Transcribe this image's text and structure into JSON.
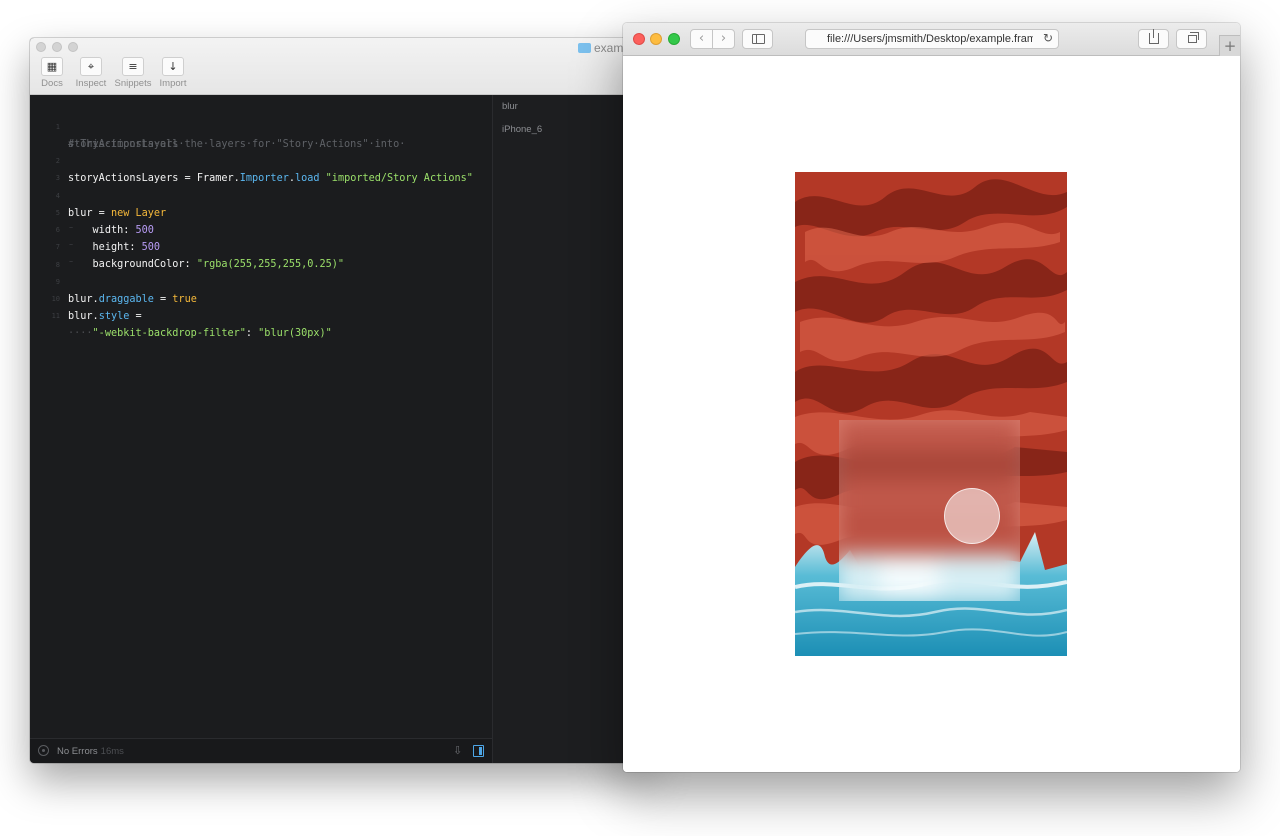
{
  "framer": {
    "title": "example",
    "toolbar": [
      {
        "label": "Docs",
        "icon": "docs-icon",
        "glyph": "▦"
      },
      {
        "label": "Inspect",
        "icon": "crosshair-icon",
        "glyph": "⌖"
      },
      {
        "label": "Snippets",
        "icon": "list-icon",
        "glyph": "≡"
      },
      {
        "label": "Import",
        "icon": "import-arrow-icon",
        "glyph": "↓"
      }
    ],
    "code": {
      "line1_comment": "#·This·imports·all·the·layers·for·\"Story·Actions\"·into·",
      "line1_wrap": "storyActionsLayers",
      "line2_var": "storyActionsLayers",
      "line2_eq": " = ",
      "line2_obj": "Framer",
      "line2_dot1": ".",
      "line2_importer": "Importer",
      "line2_dot2": ".",
      "line2_load": "load",
      "line2_str": "\"imported/Story Actions\"",
      "line4_var": "blur",
      "line4_eq": " = ",
      "line4_new": "new",
      "line4_cls": "Layer",
      "line5_key": "width: ",
      "line5_val": "500",
      "line6_key": "height: ",
      "line6_val": "500",
      "line7_key": "backgroundColor: ",
      "line7_val": "\"rgba(255,255,255,0.25)\"",
      "line9_var": "blur",
      "line9_dot": ".",
      "line9_prop": "draggable",
      "line9_eq": " = ",
      "line9_val": "true",
      "line10_var": "blur",
      "line10_dot": ".",
      "line10_prop": "style",
      "line10_eq": " =",
      "line11_indent": "····",
      "line11_key": "\"-webkit-backdrop-filter\"",
      "line11_colon": ": ",
      "line11_val": "\"blur(30px)\"",
      "indent_mark": "⁻",
      "line_numbers": [
        "1",
        "2",
        "3",
        "4",
        "5",
        "6",
        "7",
        "8",
        "9",
        "10",
        "11"
      ]
    },
    "layers": [
      "blur",
      "iPhone_6"
    ],
    "status": {
      "text": "No Errors",
      "time": "16ms"
    }
  },
  "safari": {
    "url": "file:///Users/jmsmith/Desktop/example.framer/index.html",
    "back_glyph": "‹",
    "forward_glyph": "›",
    "reload_glyph": "↻",
    "newtab_glyph": "+"
  },
  "colors": {
    "editor_bg": "#1b1c1e",
    "keyword": "#f5b83a",
    "property": "#5bb7f0",
    "string": "#9be06a",
    "number": "#b89cf5",
    "comment": "#5e6166",
    "dune_red": "#b73a28",
    "ocean": "#3aa7c4"
  }
}
